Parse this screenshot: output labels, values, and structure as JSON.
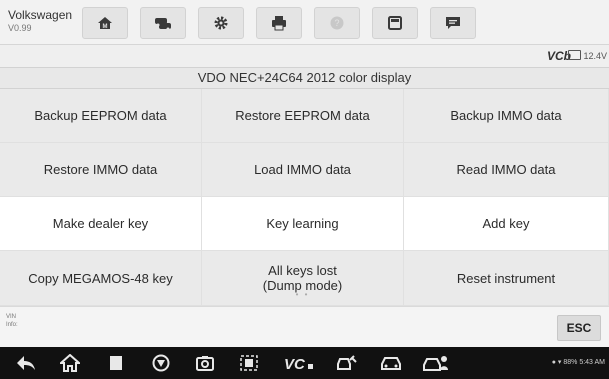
{
  "header": {
    "vehicle_name": "Volkswagen",
    "version": "V0.99",
    "toolbar_buttons": [
      {
        "icon": "home-icon"
      },
      {
        "icon": "vehicle-swap-icon"
      },
      {
        "icon": "settings-gear-icon"
      },
      {
        "icon": "print-icon"
      },
      {
        "icon": "help-icon"
      },
      {
        "icon": "save-icon"
      },
      {
        "icon": "data-logging-icon"
      }
    ]
  },
  "status": {
    "vci_label": "VCb",
    "voltage": "12.4V"
  },
  "screen_title": "VDO NEC+24C64 2012 color display",
  "functions": [
    {
      "label": "Backup EEPROM data"
    },
    {
      "label": "Restore EEPROM data"
    },
    {
      "label": "Backup IMMO data"
    },
    {
      "label": "Restore IMMO data"
    },
    {
      "label": "Load IMMO data"
    },
    {
      "label": "Read IMMO data"
    },
    {
      "label": "Make dealer key"
    },
    {
      "label": "Key learning"
    },
    {
      "label": "Add key"
    },
    {
      "label": "Copy MEGAMOS-48 key"
    },
    {
      "label_line1": "All keys lost",
      "label_line2": "(Dump mode)"
    },
    {
      "label": "Reset instrument"
    }
  ],
  "footer": {
    "vin_label": "VIN",
    "info_label": "Info:",
    "esc_label": "ESC"
  },
  "system_bar": {
    "status_text": "88% 5:43 AM"
  },
  "colors": {
    "grid_alt": "#eaeaea",
    "toolbar_bg": "#f2f2f2",
    "navbar_bg": "#111111"
  }
}
